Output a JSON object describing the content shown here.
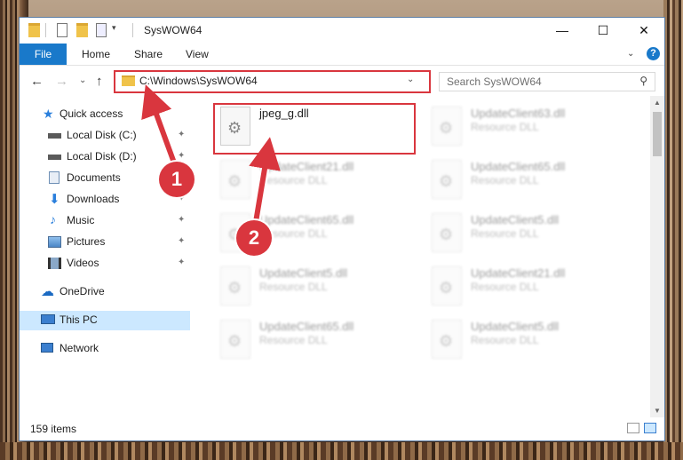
{
  "window": {
    "title": "SysWOW64",
    "minimize": "—",
    "maximize": "☐",
    "close": "✕"
  },
  "ribbon": {
    "tabs": [
      "File",
      "Home",
      "Share",
      "View"
    ],
    "chevron": "⌄",
    "help": "?"
  },
  "nav": {
    "back": "←",
    "forward": "→",
    "recent": "⌄",
    "up": "↑",
    "address": "C:\\Windows\\SysWOW64",
    "address_dropdown": "⌄",
    "refresh": "↻",
    "search_placeholder": "Search SysWOW64"
  },
  "sidebar": {
    "items": [
      {
        "label": "Quick access",
        "icon": "star-icon",
        "color": "#2a7fdc"
      },
      {
        "label": "Local Disk (C:)",
        "icon": "drive-icon",
        "color": "#4b4b4b"
      },
      {
        "label": "Local Disk (D:)",
        "icon": "drive-icon",
        "color": "#4b4b4b"
      },
      {
        "label": "Documents",
        "icon": "documents-icon",
        "color": "#6e8fb5"
      },
      {
        "label": "Downloads",
        "icon": "downloads-icon",
        "color": "#2a7fdc"
      },
      {
        "label": "Music",
        "icon": "music-icon",
        "color": "#2a7fdc"
      },
      {
        "label": "Pictures",
        "icon": "pictures-icon",
        "color": "#5a8fc9"
      },
      {
        "label": "Videos",
        "icon": "videos-icon",
        "color": "#3b3b3b"
      },
      {
        "label": "OneDrive",
        "icon": "cloud-icon",
        "color": "#1b6ac2"
      },
      {
        "label": "This PC",
        "icon": "computer-icon",
        "color": "#3b7fcf"
      },
      {
        "label": "Network",
        "icon": "network-icon",
        "color": "#3b7fcf"
      }
    ],
    "pin": "📌"
  },
  "files": [
    {
      "name": "jpeg_g.dll",
      "type": ""
    },
    {
      "name": "UpdateClient63.dll",
      "type": "Resource DLL"
    },
    {
      "name": "UpdateClient21.dll",
      "type": "Resource DLL"
    },
    {
      "name": "UpdateClient65.dll",
      "type": "Resource DLL"
    },
    {
      "name": "UpdateClient65.dll",
      "type": "Resource DLL"
    },
    {
      "name": "UpdateClient5.dll",
      "type": "Resource DLL"
    },
    {
      "name": "UpdateClient5.dll",
      "type": "Resource DLL"
    },
    {
      "name": "UpdateClient21.dll",
      "type": "Resource DLL"
    },
    {
      "name": "UpdateClient65.dll",
      "type": "Resource DLL"
    },
    {
      "name": "UpdateClient5.dll",
      "type": "Resource DLL"
    }
  ],
  "status": {
    "item_count": "159 items"
  },
  "annotations": {
    "badge1": "1",
    "badge2": "2",
    "color": "#d9363e"
  }
}
